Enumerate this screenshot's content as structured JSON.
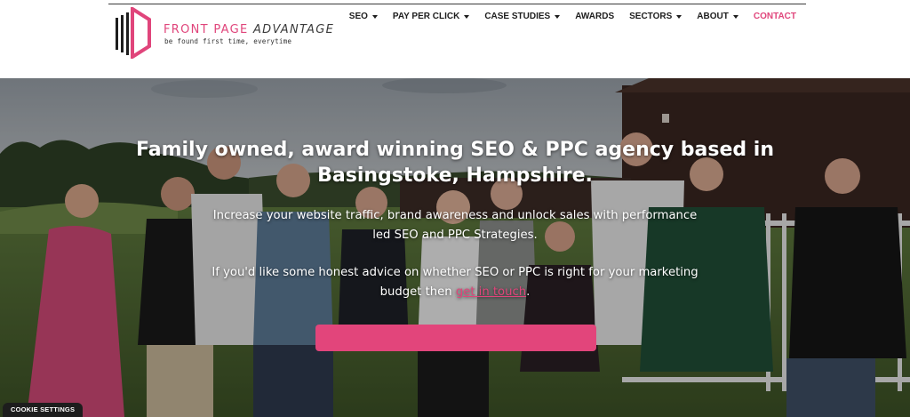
{
  "brand": {
    "name_prefix": "FRONT PAGE",
    "name_suffix": "ADVANTAGE",
    "tagline": "be found first time, everytime",
    "accent_color": "#e0457b"
  },
  "nav": {
    "items": [
      {
        "label": "SEO",
        "dropdown": true
      },
      {
        "label": "PAY PER CLICK",
        "dropdown": true
      },
      {
        "label": "CASE STUDIES",
        "dropdown": true
      },
      {
        "label": "AWARDS",
        "dropdown": false
      },
      {
        "label": "SECTORS",
        "dropdown": true
      },
      {
        "label": "ABOUT",
        "dropdown": true
      },
      {
        "label": "CONTACT",
        "dropdown": false,
        "active": true
      }
    ]
  },
  "hero": {
    "heading_line1": "Family owned, award winning SEO & PPC agency based in",
    "heading_line2": "Basingstoke, Hampshire.",
    "para1_line1": "Increase your website traffic, brand awareness and unlock sales with performance",
    "para1_line2": "led SEO and PPC Strategies.",
    "para2_line1": "If you'd like some honest advice on whether SEO or PPC is right for your marketing",
    "para2_prefix": "budget then",
    "para2_link": "get in touch",
    "para2_suffix": ".",
    "cta_color": "#e2457b"
  },
  "cookie": {
    "label": "COOKIE SETTINGS"
  }
}
